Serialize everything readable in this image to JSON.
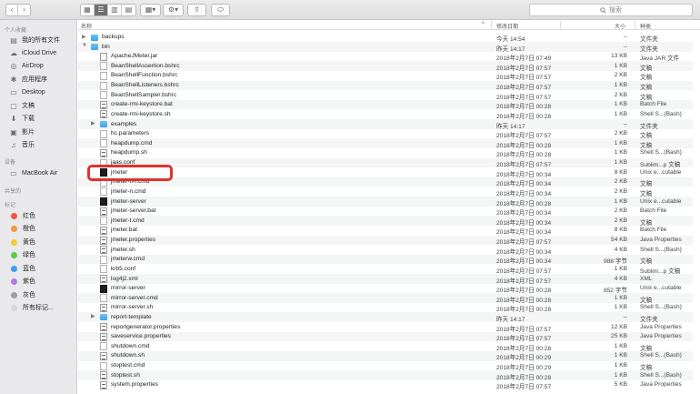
{
  "toolbar": {
    "back_icon": "chevron-left-icon",
    "forward_icon": "chevron-right-icon",
    "search_placeholder": "搜索"
  },
  "sidebar": {
    "favorites_head": "个人收藏",
    "favorites": [
      {
        "label": "我的所有文件",
        "icon": "all-files-icon"
      },
      {
        "label": "iCloud Drive",
        "icon": "cloud-icon"
      },
      {
        "label": "AirDrop",
        "icon": "airdrop-icon"
      },
      {
        "label": "应用程序",
        "icon": "applications-icon"
      },
      {
        "label": "Desktop",
        "icon": "desktop-icon"
      },
      {
        "label": "文稿",
        "icon": "documents-icon"
      },
      {
        "label": "下载",
        "icon": "download-icon"
      },
      {
        "label": "影片",
        "icon": "movies-icon"
      },
      {
        "label": "音乐",
        "icon": "music-icon"
      }
    ],
    "devices_head": "设备",
    "devices": [
      {
        "label": "MacBook Air",
        "icon": "laptop-icon"
      }
    ],
    "shared_head": "共享的",
    "tags_head": "标记",
    "tags": [
      {
        "label": "红色",
        "color": "#f0524d"
      },
      {
        "label": "橙色",
        "color": "#f49a37"
      },
      {
        "label": "黄色",
        "color": "#f3c73c"
      },
      {
        "label": "绿色",
        "color": "#5ec84a"
      },
      {
        "label": "蓝色",
        "color": "#3f9ff0"
      },
      {
        "label": "紫色",
        "color": "#b37ad6"
      },
      {
        "label": "灰色",
        "color": "#9e9e9e"
      },
      {
        "label": "所有标记...",
        "color": "#d6d6d6"
      }
    ]
  },
  "columns": {
    "name": "名称",
    "date": "修改日期",
    "size": "大小",
    "kind": "种类"
  },
  "rows": [
    {
      "name": "backups",
      "date": "今天 14:54",
      "size": "--",
      "kind": "文件夹",
      "icon": "folder",
      "level": 0,
      "disclosure": "closed"
    },
    {
      "name": "bin",
      "date": "昨天 14:17",
      "size": "--",
      "kind": "文件夹",
      "icon": "folder",
      "level": 0,
      "disclosure": "open"
    },
    {
      "name": "ApacheJMeter.jar",
      "date": "2018年2月7日 07:49",
      "size": "13 KB",
      "kind": "Java JAR 文件",
      "icon": "jar",
      "level": 1
    },
    {
      "name": "BeanShellAssertion.bshrc",
      "date": "2018年2月7日 07:57",
      "size": "1 KB",
      "kind": "文稿",
      "icon": "doc",
      "level": 1
    },
    {
      "name": "BeanShellFunction.bshrc",
      "date": "2018年2月7日 07:57",
      "size": "2 KB",
      "kind": "文稿",
      "icon": "doc",
      "level": 1
    },
    {
      "name": "BeanShellListeners.bshrc",
      "date": "2018年2月7日 07:57",
      "size": "1 KB",
      "kind": "文稿",
      "icon": "doc",
      "level": 1
    },
    {
      "name": "BeanShellSampler.bshrc",
      "date": "2018年2月7日 07:57",
      "size": "2 KB",
      "kind": "文稿",
      "icon": "doc",
      "level": 1
    },
    {
      "name": "create-rmi-keystore.bat",
      "date": "2018年2月7日 00:28",
      "size": "1 KB",
      "kind": "Batch File",
      "icon": "script",
      "level": 1
    },
    {
      "name": "create-rmi-keystore.sh",
      "date": "2018年2月7日 00:28",
      "size": "1 KB",
      "kind": "Shell S...(Bash)",
      "icon": "script",
      "level": 1
    },
    {
      "name": "examples",
      "date": "昨天 14:17",
      "size": "--",
      "kind": "文件夹",
      "icon": "folder",
      "level": 1,
      "disclosure": "closed"
    },
    {
      "name": "hc.parameters",
      "date": "2018年2月7日 07:57",
      "size": "2 KB",
      "kind": "文稿",
      "icon": "doc",
      "level": 1
    },
    {
      "name": "heapdump.cmd",
      "date": "2018年2月7日 00:28",
      "size": "1 KB",
      "kind": "文稿",
      "icon": "doc",
      "level": 1
    },
    {
      "name": "heapdump.sh",
      "date": "2018年2月7日 00:28",
      "size": "1 KB",
      "kind": "Shell S...(Bash)",
      "icon": "script",
      "level": 1
    },
    {
      "name": "jaas.conf",
      "date": "2018年2月7日 07:57",
      "size": "1 KB",
      "kind": "Sublim...p 文稿",
      "icon": "doc",
      "level": 1
    },
    {
      "name": "jmeter",
      "date": "2018年2月7日 00:34",
      "size": "8 KB",
      "kind": "Unix e...cutable",
      "icon": "exec",
      "level": 1
    },
    {
      "name": "jmeter-n-r.cmd",
      "date": "2018年2月7日 00:34",
      "size": "2 KB",
      "kind": "文稿",
      "icon": "doc",
      "level": 1
    },
    {
      "name": "jmeter-n.cmd",
      "date": "2018年2月7日 00:34",
      "size": "2 KB",
      "kind": "文稿",
      "icon": "doc",
      "level": 1
    },
    {
      "name": "jmeter-server",
      "date": "2018年2月7日 00:28",
      "size": "1 KB",
      "kind": "Unix e...cutable",
      "icon": "exec",
      "level": 1
    },
    {
      "name": "jmeter-server.bat",
      "date": "2018年2月7日 00:34",
      "size": "2 KB",
      "kind": "Batch File",
      "icon": "script",
      "level": 1
    },
    {
      "name": "jmeter-t.cmd",
      "date": "2018年2月7日 00:34",
      "size": "2 KB",
      "kind": "文稿",
      "icon": "doc",
      "level": 1
    },
    {
      "name": "jmeter.bat",
      "date": "2018年2月7日 00:34",
      "size": "8 KB",
      "kind": "Batch File",
      "icon": "script",
      "level": 1
    },
    {
      "name": "jmeter.properties",
      "date": "2018年2月7日 07:57",
      "size": "54 KB",
      "kind": "Java Properties",
      "icon": "script",
      "level": 1
    },
    {
      "name": "jmeter.sh",
      "date": "2018年2月7日 00:34",
      "size": "4 KB",
      "kind": "Shell S...(Bash)",
      "icon": "script",
      "level": 1
    },
    {
      "name": "jmeterw.cmd",
      "date": "2018年2月7日 00:34",
      "size": "988 字节",
      "kind": "文稿",
      "icon": "doc",
      "level": 1
    },
    {
      "name": "krb5.conf",
      "date": "2018年2月7日 07:57",
      "size": "1 KB",
      "kind": "Sublim...p 文稿",
      "icon": "doc",
      "level": 1
    },
    {
      "name": "log4j2.xml",
      "date": "2018年2月7日 07:57",
      "size": "4 KB",
      "kind": "XML",
      "icon": "script",
      "level": 1
    },
    {
      "name": "mirror-server",
      "date": "2018年2月7日 00:28",
      "size": "852 字节",
      "kind": "Unix e...cutable",
      "icon": "exec",
      "level": 1
    },
    {
      "name": "mirror-server.cmd",
      "date": "2018年2月7日 00:28",
      "size": "1 KB",
      "kind": "文稿",
      "icon": "doc",
      "level": 1
    },
    {
      "name": "mirror-server.sh",
      "date": "2018年2月7日 00:28",
      "size": "1 KB",
      "kind": "Shell S...(Bash)",
      "icon": "script",
      "level": 1
    },
    {
      "name": "report-template",
      "date": "昨天 14:17",
      "size": "--",
      "kind": "文件夹",
      "icon": "folder",
      "level": 1,
      "disclosure": "closed"
    },
    {
      "name": "reportgenerator.properties",
      "date": "2018年2月7日 07:57",
      "size": "12 KB",
      "kind": "Java Properties",
      "icon": "script",
      "level": 1
    },
    {
      "name": "saveservice.properties",
      "date": "2018年2月7日 07:57",
      "size": "25 KB",
      "kind": "Java Properties",
      "icon": "script",
      "level": 1
    },
    {
      "name": "shutdown.cmd",
      "date": "2018年2月7日 00:28",
      "size": "1 KB",
      "kind": "文稿",
      "icon": "doc",
      "level": 1
    },
    {
      "name": "shutdown.sh",
      "date": "2018年2月7日 00:29",
      "size": "1 KB",
      "kind": "Shell S...(Bash)",
      "icon": "script",
      "level": 1
    },
    {
      "name": "stoptest.cmd",
      "date": "2018年2月7日 00:29",
      "size": "1 KB",
      "kind": "文稿",
      "icon": "doc",
      "level": 1
    },
    {
      "name": "stoptest.sh",
      "date": "2018年2月7日 00:28",
      "size": "1 KB",
      "kind": "Shell S...(Bash)",
      "icon": "script",
      "level": 1
    },
    {
      "name": "system.properties",
      "date": "2018年2月7日 07:57",
      "size": "5 KB",
      "kind": "Java Properties",
      "icon": "script",
      "level": 1
    }
  ]
}
